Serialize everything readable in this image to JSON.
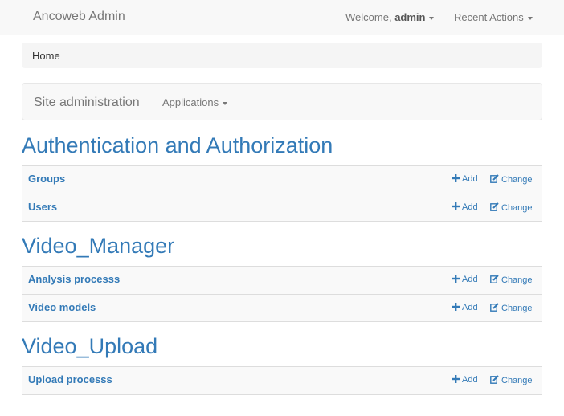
{
  "navbar": {
    "brand": "Ancoweb Admin",
    "welcome_prefix": "Welcome,",
    "user": "admin",
    "recent_actions": "Recent Actions"
  },
  "breadcrumb": {
    "home": "Home"
  },
  "subnav": {
    "title": "Site administration",
    "applications": "Applications"
  },
  "sections": [
    {
      "title": "Authentication and Authorization",
      "models": [
        {
          "name": "Groups",
          "add": "Add",
          "change": "Change"
        },
        {
          "name": "Users",
          "add": "Add",
          "change": "Change"
        }
      ]
    },
    {
      "title": "Video_Manager",
      "models": [
        {
          "name": "Analysis processs",
          "add": "Add",
          "change": "Change"
        },
        {
          "name": "Video models",
          "add": "Add",
          "change": "Change"
        }
      ]
    },
    {
      "title": "Video_Upload",
      "models": [
        {
          "name": "Upload processs",
          "add": "Add",
          "change": "Change"
        }
      ]
    }
  ],
  "icons": {
    "add": "plus-icon",
    "change": "edit-icon",
    "dropdown": "caret-down-icon"
  },
  "colors": {
    "link": "#337ab7",
    "navbar_bg": "#f8f8f8",
    "muted": "#777777"
  }
}
